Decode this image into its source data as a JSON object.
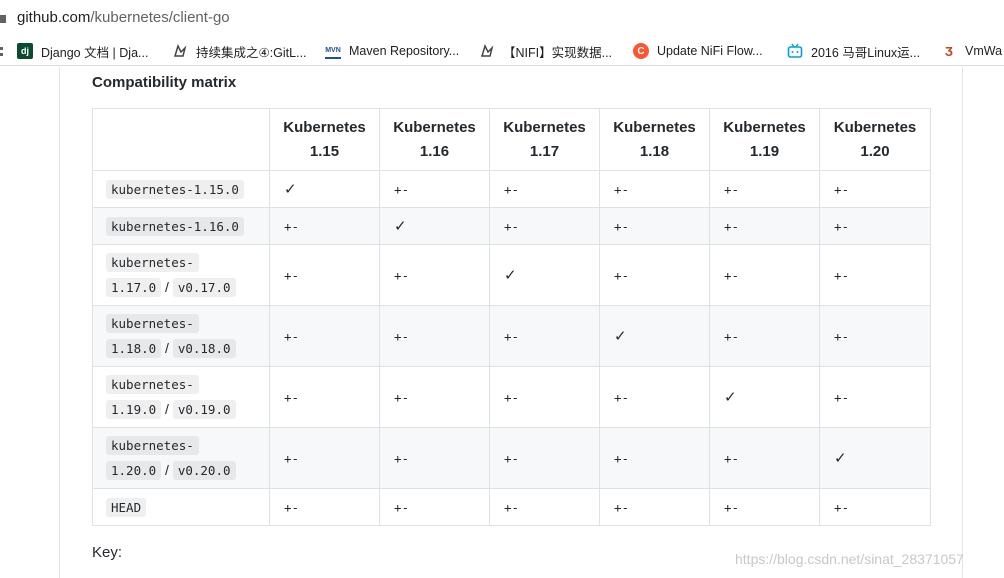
{
  "browser": {
    "url_host": "github.com",
    "url_path": "/kubernetes/client-go",
    "bookmarks": [
      {
        "label": "Django 文档 | Dja...",
        "icon": "django-icon"
      },
      {
        "label": "持续集成之④:GitL...",
        "icon": "wolf-icon"
      },
      {
        "label": "Maven Repository...",
        "icon": "maven-icon"
      },
      {
        "label": "【NIFI】实现数据...",
        "icon": "wolf-icon"
      },
      {
        "label": "Update NiFi Flow...",
        "icon": "csdn-icon"
      },
      {
        "label": "2016 马哥Linux运...",
        "icon": "bilibili-icon"
      },
      {
        "label": "VmWa",
        "icon": "jb-icon"
      }
    ]
  },
  "section": {
    "heading": "Compatibility matrix",
    "key_label": "Key:"
  },
  "matrix": {
    "headers": [
      {
        "line1": "Kubernetes",
        "line2": "1.15"
      },
      {
        "line1": "Kubernetes",
        "line2": "1.16"
      },
      {
        "line1": "Kubernetes",
        "line2": "1.17"
      },
      {
        "line1": "Kubernetes",
        "line2": "1.18"
      },
      {
        "line1": "Kubernetes",
        "line2": "1.19"
      },
      {
        "line1": "Kubernetes",
        "line2": "1.20"
      }
    ],
    "rows": [
      {
        "a": "kubernetes-1.15.0",
        "b": "",
        "sep": "",
        "cells": [
          "✓",
          "+-",
          "+-",
          "+-",
          "+-",
          "+-"
        ]
      },
      {
        "a": "kubernetes-1.16.0",
        "b": "",
        "sep": "",
        "cells": [
          "+-",
          "✓",
          "+-",
          "+-",
          "+-",
          "+-"
        ]
      },
      {
        "a": "kubernetes-",
        "b": "1.17.0",
        "sep": "/",
        "c": "v0.17.0",
        "cells": [
          "+-",
          "+-",
          "✓",
          "+-",
          "+-",
          "+-"
        ]
      },
      {
        "a": "kubernetes-",
        "b": "1.18.0",
        "sep": "/",
        "c": "v0.18.0",
        "cells": [
          "+-",
          "+-",
          "+-",
          "✓",
          "+-",
          "+-"
        ]
      },
      {
        "a": "kubernetes-",
        "b": "1.19.0",
        "sep": "/",
        "c": "v0.19.0",
        "cells": [
          "+-",
          "+-",
          "+-",
          "+-",
          "✓",
          "+-"
        ]
      },
      {
        "a": "kubernetes-",
        "b": "1.20.0",
        "sep": "/",
        "c": "v0.20.0",
        "cells": [
          "+-",
          "+-",
          "+-",
          "+-",
          "+-",
          "✓"
        ]
      },
      {
        "a": "HEAD",
        "b": "",
        "sep": "",
        "cells": [
          "+-",
          "+-",
          "+-",
          "+-",
          "+-",
          "+-"
        ]
      }
    ]
  },
  "watermark": "https://blog.csdn.net/sinat_28371057"
}
